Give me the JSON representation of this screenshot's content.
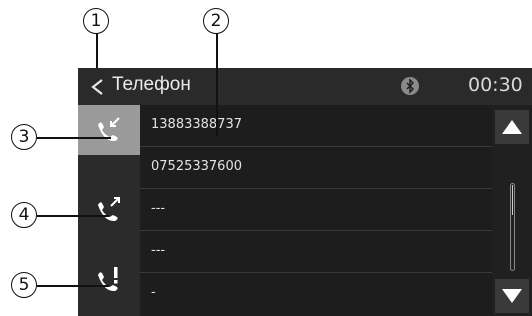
{
  "callouts": [
    "1",
    "2",
    "3",
    "4",
    "5"
  ],
  "header": {
    "title": "Телефон",
    "time": "00:30",
    "back_icon": "chevron-left-icon",
    "status_icon": "bluetooth-icon"
  },
  "sidebar": {
    "items": [
      {
        "name": "received-calls",
        "icon": "incoming-call-icon",
        "active": true
      },
      {
        "name": "dialed-calls",
        "icon": "outgoing-call-icon",
        "active": false
      },
      {
        "name": "missed-calls",
        "icon": "missed-call-icon",
        "active": false
      }
    ]
  },
  "calls": [
    "13883388737",
    "07525337600",
    "---",
    "---",
    "-"
  ],
  "scroll": {
    "up_icon": "triangle-up-icon",
    "down_icon": "triangle-down-icon"
  },
  "colors": {
    "screen_bg": "#1d1d1d",
    "active_tab": "#9a9a9a",
    "text": "#e2e2e2"
  }
}
